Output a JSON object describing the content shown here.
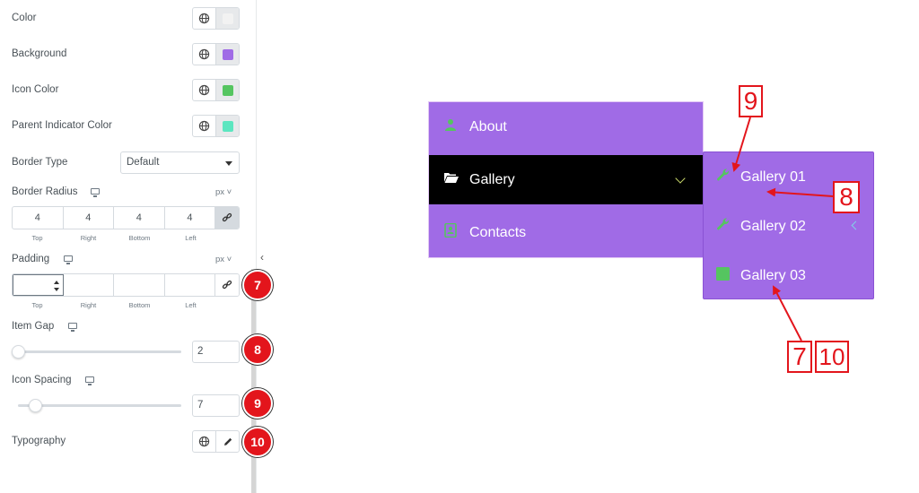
{
  "panel": {
    "color_label": "Color",
    "background_label": "Background",
    "icon_color_label": "Icon Color",
    "parent_indicator_label": "Parent Indicator Color",
    "border_type_label": "Border Type",
    "border_type_value": "Default",
    "border_radius_label": "Border Radius",
    "border_radius_unit": "px",
    "border_radius_values": [
      "4",
      "4",
      "4",
      "4"
    ],
    "dimension_labels": [
      "Top",
      "Right",
      "Bottom",
      "Left"
    ],
    "padding_label": "Padding",
    "padding_unit": "px",
    "item_gap_label": "Item Gap",
    "item_gap_value": "2",
    "icon_spacing_label": "Icon Spacing",
    "icon_spacing_value": "7",
    "typography_label": "Typography",
    "collapse_glyph": "‹"
  },
  "swatches": {
    "color": "#f2f2f2",
    "background": "#a06be6",
    "icon_color": "#55c560",
    "parent_indicator": "#5ce6c0"
  },
  "badges": [
    "7",
    "8",
    "9",
    "10"
  ],
  "menu": {
    "items": [
      "About",
      "Gallery",
      "Contacts"
    ],
    "submenu": [
      "Gallery 01",
      "Gallery 02",
      "Gallery 03"
    ]
  },
  "annotations": {
    "box_9": "9",
    "box_8": "8",
    "box_7": "7",
    "box_10": "10"
  },
  "colors": {
    "menu_bg": "#a06be6",
    "active_bg": "#000000",
    "icon_green": "#55c560",
    "annotation_red": "#e3151c"
  }
}
